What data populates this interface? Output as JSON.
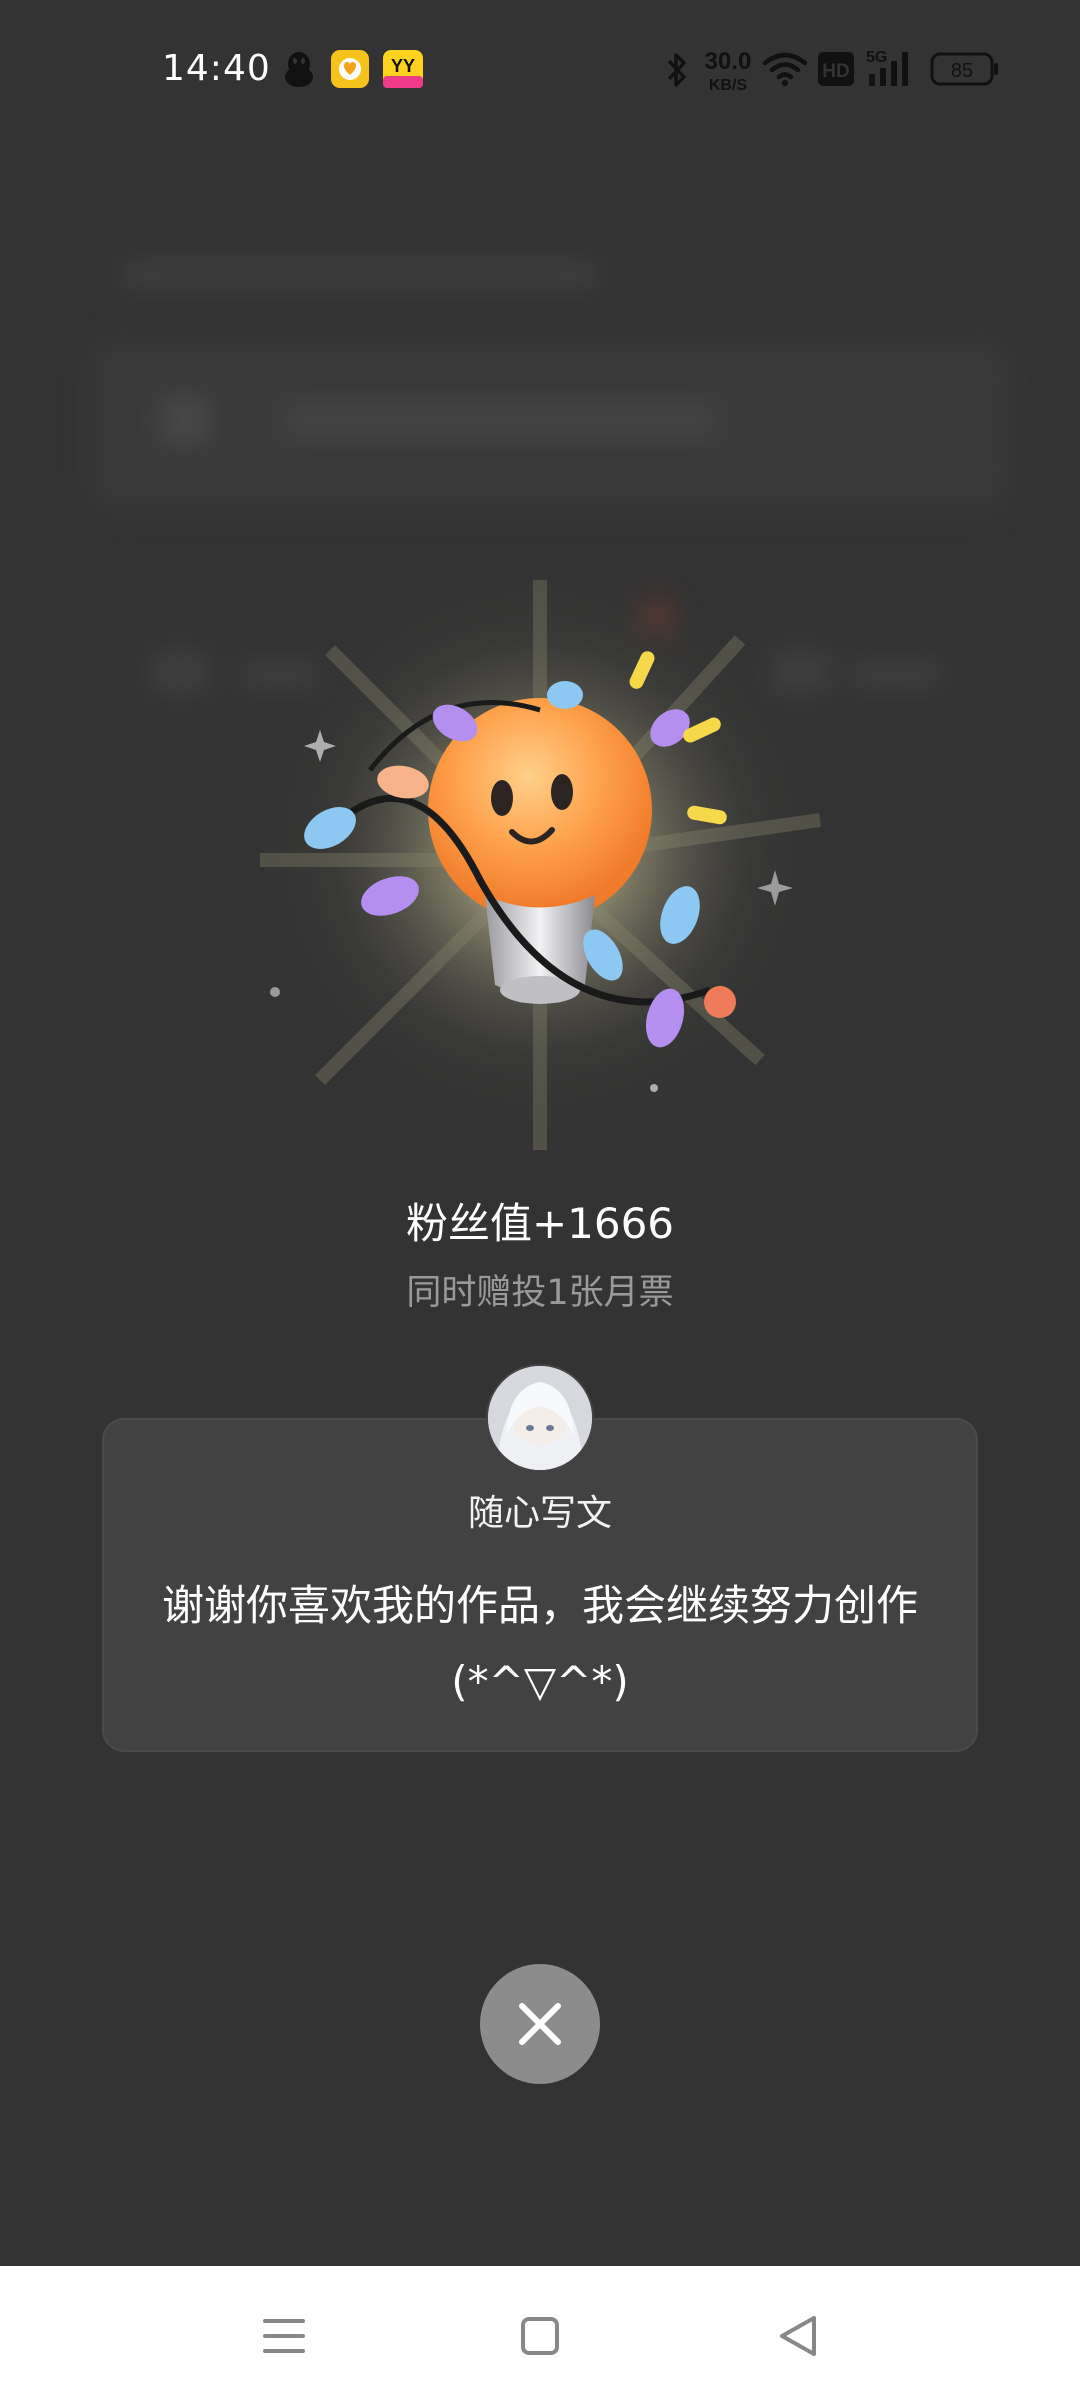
{
  "status_bar": {
    "time": "14:40",
    "net_speed_value": "30.0",
    "net_speed_unit": "KB/S",
    "hd_label": "HD",
    "signal_label": "5G",
    "battery_level": "85",
    "notification_icons": [
      "qq-penguin-icon",
      "heart-app-icon",
      "yy-app-icon"
    ],
    "yy_label": "YY"
  },
  "reward": {
    "title": "粉丝值+1666",
    "subtitle": "同时赠投1张月票"
  },
  "author_card": {
    "name": "随心写文",
    "message": "谢谢你喜欢我的作品，我会继续努力创作(*^▽^*)"
  },
  "close_button": {
    "icon": "close-icon"
  },
  "nav_bar": {
    "items": [
      "menu-icon",
      "home-icon",
      "back-icon"
    ]
  },
  "colors": {
    "background": "#333333",
    "card": "#424242",
    "close_button": "#8c8c8c",
    "subtitle_text": "#9a9a9a",
    "nav_background": "#ffffff"
  }
}
